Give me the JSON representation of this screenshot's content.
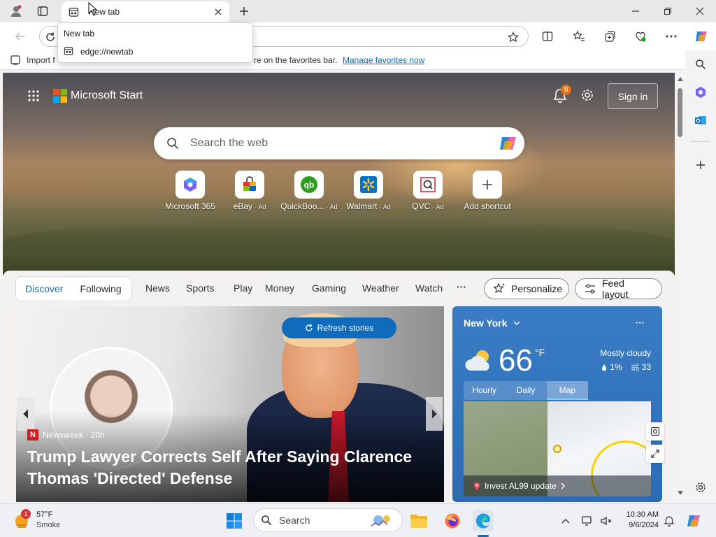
{
  "browser": {
    "tab": {
      "title": "New tab",
      "close_icon": "close-icon"
    },
    "tab_popup": {
      "title": "New tab",
      "url": "edge://newtab"
    },
    "window_controls": {
      "minimize": "minimize-icon",
      "restore": "restore-icon",
      "close": "close-icon"
    },
    "favorites_bar": {
      "text_left": "Import f",
      "text_mid": "re on the favorites bar.",
      "link": "Manage favorites now"
    }
  },
  "newtab": {
    "brand": "Microsoft Start",
    "notification_count": "8",
    "sign_in": "Sign in",
    "search": {
      "placeholder": "Search the web"
    },
    "shortcuts": [
      {
        "label": "Microsoft 365",
        "ad": ""
      },
      {
        "label": "eBay",
        "ad": "· Ad"
      },
      {
        "label": "QuickBoo...",
        "ad": "· Ad"
      },
      {
        "label": "Walmart",
        "ad": "· Ad"
      },
      {
        "label": "QVC",
        "ad": "· Ad"
      },
      {
        "label": "Add shortcut",
        "ad": ""
      }
    ],
    "nav": {
      "pills": [
        "Discover",
        "Following"
      ],
      "links": [
        "News",
        "Sports",
        "Play",
        "Money",
        "Gaming",
        "Weather",
        "Watch"
      ],
      "more": "···",
      "personalize": "Personalize",
      "feed_layout": "Feed layout"
    },
    "story": {
      "refresh": "Refresh stories",
      "source": "Newsweek · 20h",
      "source_badge": "N",
      "headline": "Trump Lawyer Corrects Self After Saying Clarence Thomas 'Directed' Defense"
    },
    "weather": {
      "location": "New York",
      "more": "···",
      "temp": "66",
      "unit": "°F",
      "condition": "Mostly cloudy",
      "precip": "1%",
      "wind": "33",
      "tabs": [
        "Hourly",
        "Daily",
        "Map"
      ],
      "active_tab": "Map",
      "map_alert": "Invest AL99 update"
    }
  },
  "taskbar": {
    "weather_temp": "57°F",
    "weather_desc": "Smoke",
    "weather_badge": "1",
    "search_placeholder": "Search",
    "time": "10:30 AM",
    "date": "9/6/2024"
  }
}
